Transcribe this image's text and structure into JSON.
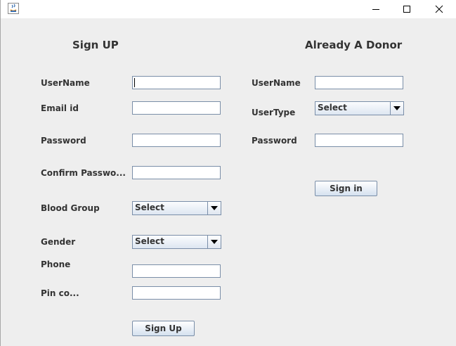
{
  "window": {
    "controls": {
      "minimize": "—",
      "maximize": "☐",
      "close": "✕"
    }
  },
  "signup": {
    "title": "Sign UP",
    "labels": {
      "username": "UserName",
      "email": "Email id",
      "password": "Password",
      "confirm": "Confirm Passwo...",
      "blood_group": "Blood Group",
      "gender": "Gender",
      "phone": "Phone",
      "pin": "Pin co..."
    },
    "values": {
      "username": "",
      "email": "",
      "password": "",
      "confirm": "",
      "phone": "",
      "pin": ""
    },
    "blood_group_selected": "Select",
    "gender_selected": "Select",
    "button": "Sign Up"
  },
  "login": {
    "title": "Already A Donor",
    "labels": {
      "username": "UserName",
      "usertype": "UserType",
      "password": "Password"
    },
    "values": {
      "username": "",
      "password": ""
    },
    "usertype_selected": "Select",
    "button": "Sign in"
  }
}
